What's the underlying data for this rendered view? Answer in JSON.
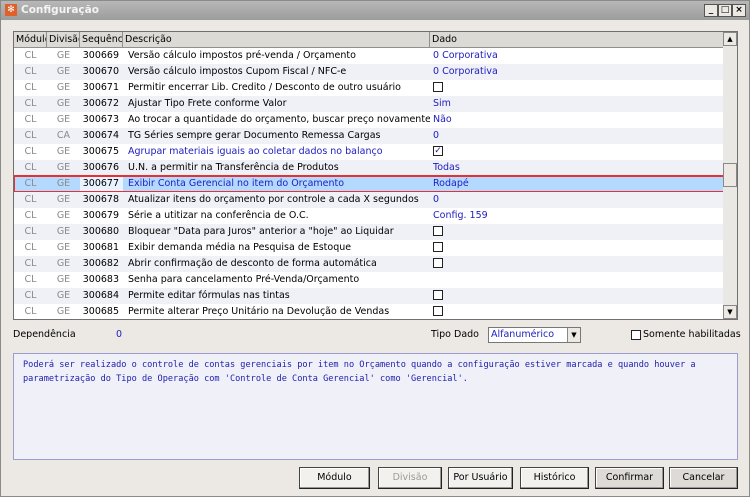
{
  "window": {
    "title": "Configuração",
    "minimize": "_",
    "maximize": "□",
    "close": "×"
  },
  "grid": {
    "columns": [
      "Módulo",
      "Divisão",
      "Sequência",
      "Descrição",
      "Dado"
    ],
    "rows": [
      {
        "modulo": "CL",
        "divisao": "GE",
        "seq": "300669",
        "desc": "Versão cálculo impostos pré-venda / Orçamento",
        "dado": "0 Corporativa",
        "type": "text"
      },
      {
        "modulo": "CL",
        "divisao": "GE",
        "seq": "300670",
        "desc": "Versão cálculo impostos Cupom Fiscal / NFC-e",
        "dado": "0 Corporativa",
        "type": "text"
      },
      {
        "modulo": "CL",
        "divisao": "GE",
        "seq": "300671",
        "desc": "Permitir encerrar Lib. Credito / Desconto de outro usuário",
        "checked": false,
        "type": "check"
      },
      {
        "modulo": "CL",
        "divisao": "GE",
        "seq": "300672",
        "desc": "Ajustar Tipo Frete conforme Valor",
        "dado": "Sim",
        "type": "text"
      },
      {
        "modulo": "CL",
        "divisao": "GE",
        "seq": "300673",
        "desc": "Ao trocar a quantidade do orçamento, buscar preço novamente",
        "dado": "Não",
        "type": "text"
      },
      {
        "modulo": "CL",
        "divisao": "CA",
        "seq": "300674",
        "desc": "TG Séries sempre gerar Documento Remessa Cargas",
        "dado": "0",
        "type": "text"
      },
      {
        "modulo": "CL",
        "divisao": "GE",
        "seq": "300675",
        "desc": "Agrupar materiais iguais ao coletar dados no balanço",
        "checked": true,
        "type": "check",
        "blue": true
      },
      {
        "modulo": "CL",
        "divisao": "GE",
        "seq": "300676",
        "desc": "U.N. a permitir na Transferência de Produtos",
        "dado": "Todas",
        "type": "text"
      },
      {
        "modulo": "CL",
        "divisao": "GE",
        "seq": "300677",
        "desc": "Exibir Conta Gerencial no item do Orçamento",
        "dado": "Rodapé",
        "type": "text",
        "selected": true
      },
      {
        "modulo": "CL",
        "divisao": "GE",
        "seq": "300678",
        "desc": "Atualizar itens do orçamento por controle a cada X segundos",
        "dado": "0",
        "type": "text"
      },
      {
        "modulo": "CL",
        "divisao": "GE",
        "seq": "300679",
        "desc": "Série a utitizar na conferência de O.C.",
        "dado": "Config. 159",
        "type": "text"
      },
      {
        "modulo": "CL",
        "divisao": "GE",
        "seq": "300680",
        "desc": "Bloquear \"Data para Juros\" anterior a \"hoje\" ao Liquidar",
        "checked": false,
        "type": "check"
      },
      {
        "modulo": "CL",
        "divisao": "GE",
        "seq": "300681",
        "desc": "Exibir demanda média na Pesquisa de Estoque",
        "checked": false,
        "type": "check"
      },
      {
        "modulo": "CL",
        "divisao": "GE",
        "seq": "300682",
        "desc": "Abrir confirmação de desconto de forma automática",
        "checked": false,
        "type": "check"
      },
      {
        "modulo": "CL",
        "divisao": "GE",
        "seq": "300683",
        "desc": "Senha para cancelamento Pré-Venda/Orçamento",
        "dado": "",
        "type": "text"
      },
      {
        "modulo": "CL",
        "divisao": "GE",
        "seq": "300684",
        "desc": "Permite editar fórmulas nas tintas",
        "checked": false,
        "type": "check"
      },
      {
        "modulo": "CL",
        "divisao": "GE",
        "seq": "300685",
        "desc": "Permite alterar Preço Unitário na Devolução de Vendas",
        "checked": false,
        "type": "check"
      }
    ]
  },
  "footer": {
    "dependencia_label": "Dependência",
    "dependencia_value": "0",
    "tipo_dado_label": "Tipo Dado",
    "tipo_dado_value": "Alfanumérico",
    "somente_label": "Somente habilitadas"
  },
  "description": "Poderá ser realizado o controle de contas gerenciais por item no Orçamento quando a configuração estiver marcada e quando houver a parametrização do Tipo de Operação com 'Controle de Conta Gerencial' como 'Gerencial'.",
  "buttons": {
    "modulo": "Módulo",
    "divisao": "Divisão",
    "por_usuario": "Por Usuário",
    "historico": "Histórico",
    "confirmar": "Confirmar",
    "cancelar": "Cancelar"
  }
}
